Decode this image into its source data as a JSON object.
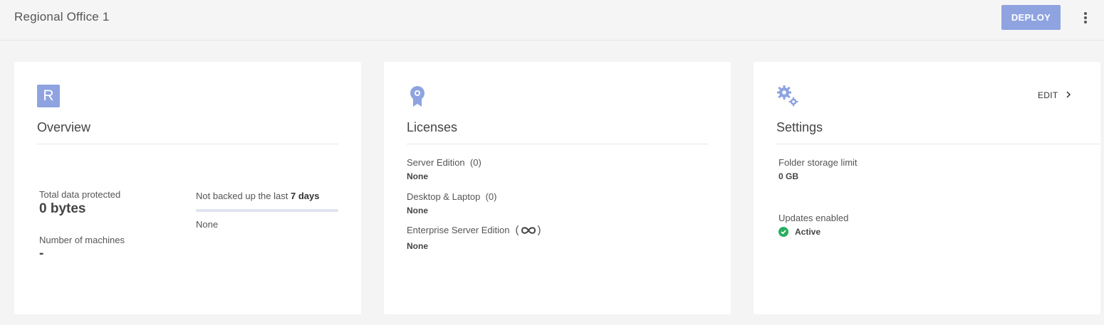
{
  "header": {
    "title": "Regional Office 1",
    "deploy_label": "DEPLOY"
  },
  "overview": {
    "avatar_letter": "R",
    "title": "Overview",
    "total_data_label": "Total data protected",
    "total_data_value": "0 bytes",
    "machines_label": "Number of machines",
    "machines_value": "-",
    "not_backed_prefix": "Not backed up the last",
    "not_backed_days": "7 days",
    "not_backed_value": "None",
    "not_backed_progress": 0
  },
  "licenses": {
    "title": "Licenses",
    "items": [
      {
        "name": "Server Edition",
        "count": "(0)",
        "value": "None"
      },
      {
        "name": "Desktop & Laptop",
        "count": "(0)",
        "value": "None"
      },
      {
        "name": "Enterprise Server Edition",
        "count_icon": "infinity-icon",
        "value": "None"
      }
    ]
  },
  "settings": {
    "title": "Settings",
    "edit_label": "EDIT",
    "folder_limit_label": "Folder storage limit",
    "folder_limit_value": "0 GB",
    "updates_label": "Updates enabled",
    "updates_value": "Active"
  },
  "colors": {
    "accent": "#8ea3e0",
    "active_green": "#27ae60"
  }
}
